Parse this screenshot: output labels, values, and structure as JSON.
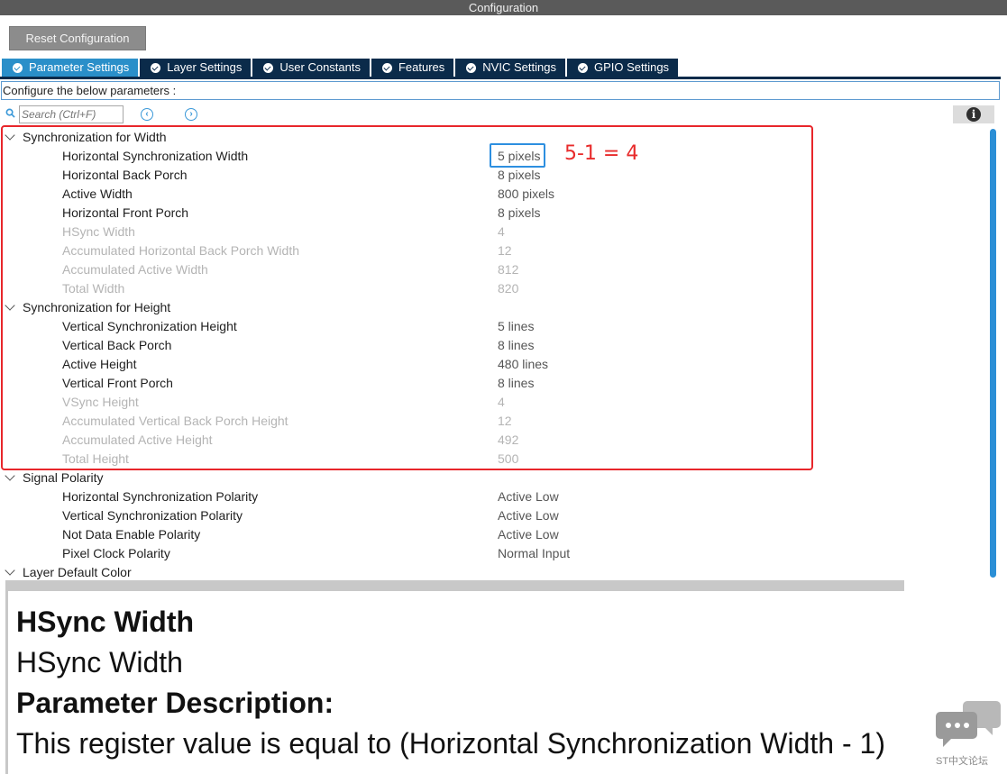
{
  "window": {
    "title": "Configuration"
  },
  "toolbar": {
    "reset_label": "Reset Configuration"
  },
  "tabs": [
    {
      "label": "Parameter Settings",
      "active": true
    },
    {
      "label": "Layer Settings",
      "active": false
    },
    {
      "label": "User Constants",
      "active": false
    },
    {
      "label": "Features",
      "active": false
    },
    {
      "label": "NVIC Settings",
      "active": false
    },
    {
      "label": "GPIO Settings",
      "active": false
    }
  ],
  "config_label": "Configure the below parameters :",
  "search": {
    "placeholder": "Search (Ctrl+F)",
    "value": ""
  },
  "groups": [
    {
      "label": "Synchronization for Width",
      "params": [
        {
          "name": "Horizontal Synchronization Width",
          "value": "5 pixels",
          "dim": false
        },
        {
          "name": "Horizontal Back Porch",
          "value": "8 pixels",
          "dim": false
        },
        {
          "name": "Active Width",
          "value": "800 pixels",
          "dim": false
        },
        {
          "name": "Horizontal Front Porch",
          "value": "8 pixels",
          "dim": false
        },
        {
          "name": "HSync Width",
          "value": "4",
          "dim": true
        },
        {
          "name": "Accumulated Horizontal Back Porch Width",
          "value": "12",
          "dim": true
        },
        {
          "name": "Accumulated Active Width",
          "value": "812",
          "dim": true
        },
        {
          "name": "Total Width",
          "value": "820",
          "dim": true
        }
      ]
    },
    {
      "label": "Synchronization for Height",
      "params": [
        {
          "name": "Vertical Synchronization Height",
          "value": "5 lines",
          "dim": false
        },
        {
          "name": "Vertical Back Porch",
          "value": "8 lines",
          "dim": false
        },
        {
          "name": "Active Height",
          "value": "480 lines",
          "dim": false
        },
        {
          "name": "Vertical Front Porch",
          "value": "8 lines",
          "dim": false
        },
        {
          "name": "VSync Height",
          "value": "4",
          "dim": true
        },
        {
          "name": "Accumulated Vertical Back Porch Height",
          "value": "12",
          "dim": true
        },
        {
          "name": "Accumulated Active Height",
          "value": "492",
          "dim": true
        },
        {
          "name": "Total Height",
          "value": "500",
          "dim": true
        }
      ]
    },
    {
      "label": "Signal Polarity",
      "params": [
        {
          "name": "Horizontal Synchronization Polarity",
          "value": "Active Low",
          "dim": false
        },
        {
          "name": "Vertical Synchronization Polarity",
          "value": "Active Low",
          "dim": false
        },
        {
          "name": "Not Data Enable Polarity",
          "value": "Active Low",
          "dim": false
        },
        {
          "name": "Pixel Clock Polarity",
          "value": "Normal Input",
          "dim": false
        }
      ]
    },
    {
      "label": "Layer Default Color",
      "params": []
    }
  ],
  "annotation": "5-1 = 4",
  "description": {
    "title": "HSync Width",
    "subtitle": "HSync Width",
    "heading": "Parameter Description:",
    "text": "This register value is equal to (Horizontal Synchronization Width - 1)"
  },
  "watermark": {
    "text": "ST中文论坛"
  },
  "colors": {
    "tab_active": "#2a8fc9",
    "tab_inactive": "#0b2b4a",
    "highlight_red": "#e8262b",
    "highlight_blue": "#2d8fe0"
  }
}
